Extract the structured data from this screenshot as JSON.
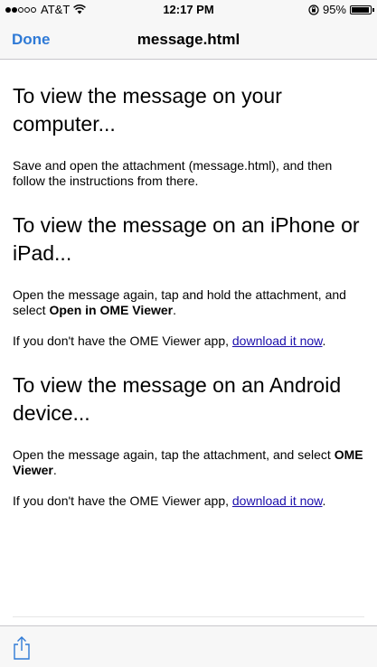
{
  "status_bar": {
    "carrier": "AT&T",
    "time": "12:17 PM",
    "battery_percent": "95%",
    "battery_level": 0.95,
    "signal_bars_filled": 2,
    "signal_bars_total": 5
  },
  "nav": {
    "done_label": "Done",
    "title": "message.html"
  },
  "content": {
    "sections": [
      {
        "heading": "To view the message on your computer...",
        "para1": "Save and open the attachment (message.html), and then follow the instructions from there."
      },
      {
        "heading": "To view the message on an iPhone or iPad...",
        "para1_pre": "Open the message again, tap and hold the attachment, and select ",
        "para1_bold": "Open in OME Viewer",
        "para1_post": ".",
        "para2_pre": "If you don't have the OME Viewer app, ",
        "para2_link": "download it now",
        "para2_post": "."
      },
      {
        "heading": "To view the message on an Android device...",
        "para1_pre": "Open the message again, tap the attachment, and select ",
        "para1_bold": "OME Viewer",
        "para1_post": ".",
        "para2_pre": "If you don't have the OME Viewer app, ",
        "para2_link": "download it now",
        "para2_post": "."
      }
    ]
  },
  "toolbar": {
    "share_icon": "share-icon"
  },
  "colors": {
    "accent": "#2f7ad6",
    "link": "#1a0dab",
    "bar_background": "#f7f7f7"
  }
}
